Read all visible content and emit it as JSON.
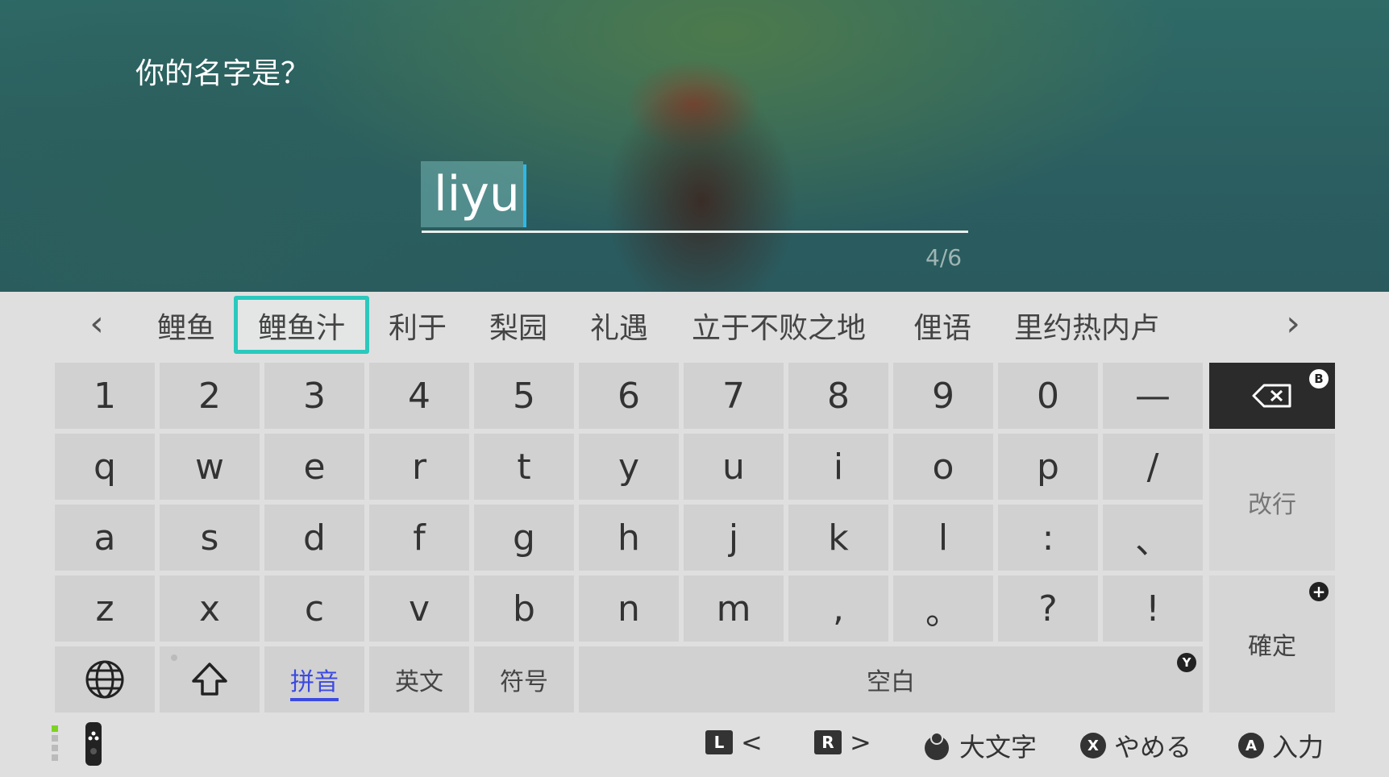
{
  "prompt": "你的名字是？",
  "input": {
    "value": "liyu",
    "counter": "4/6"
  },
  "candidates": {
    "prev_icon": "chevron-left-icon",
    "next_icon": "chevron-right-icon",
    "items": [
      "鲤鱼",
      "鲤鱼汁",
      "利于",
      "梨园",
      "礼遇",
      "立于不败之地",
      "俚语",
      "里约热内卢"
    ],
    "selected_index": 1
  },
  "keys": {
    "row1": [
      "1",
      "2",
      "3",
      "4",
      "5",
      "6",
      "7",
      "8",
      "9",
      "0",
      "—"
    ],
    "row2": [
      "q",
      "w",
      "e",
      "r",
      "t",
      "y",
      "u",
      "i",
      "o",
      "p",
      "/"
    ],
    "row3": [
      "a",
      "s",
      "d",
      "f",
      "g",
      "h",
      "j",
      "k",
      "l",
      ":",
      "、"
    ],
    "row4": [
      "z",
      "x",
      "c",
      "v",
      "b",
      "n",
      "m",
      ",",
      "。",
      "?",
      "!"
    ]
  },
  "bottom_row": {
    "globe_icon": "globe-icon",
    "shift_icon": "shift-arrow-icon",
    "pinyin": "拼音",
    "english": "英文",
    "symbols": "符号",
    "space": "空白",
    "space_badge": "Y"
  },
  "side_keys": {
    "backspace_icon": "backspace-icon",
    "backspace_badge": "B",
    "newline": "改行",
    "confirm": "確定",
    "confirm_badge": "+"
  },
  "hints": {
    "l_button": "L",
    "l_arrow": "<",
    "r_button": "R",
    "r_arrow": ">",
    "stick_label": "大文字",
    "x_button": "X",
    "x_label": "やめる",
    "a_button": "A",
    "a_label": "入力"
  },
  "colors": {
    "selection_border": "#2bc9bd",
    "caret": "#30b8e6",
    "active_mode_underline": "#3c4ae0",
    "controller_indicator": "#7ed321"
  }
}
